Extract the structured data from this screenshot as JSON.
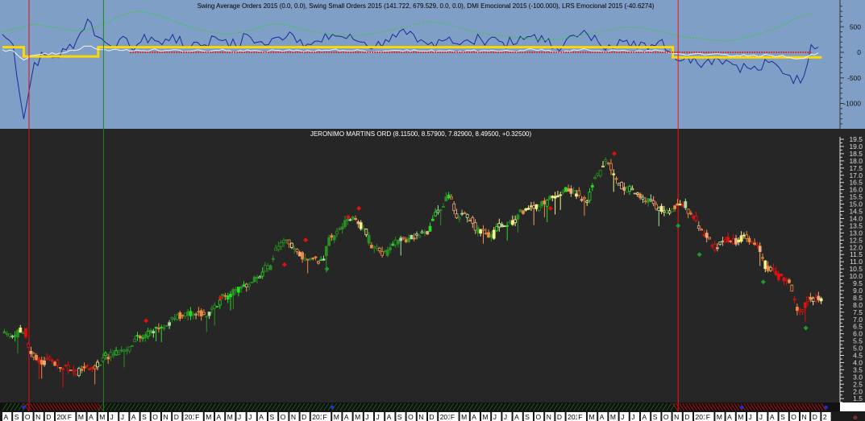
{
  "top_panel": {
    "title": "Swing Average Orders 2015 (0.0, 0.0), Swing Small Orders 2015 (141.722, 679.529, 0.0, 0.0), DMI Emocional 2015 (-100.000), LRS Emocional 2015 (-40.6274)",
    "y_ticks": [
      "500",
      "0",
      "-500",
      "-1000"
    ]
  },
  "price_panel": {
    "title": "JERONIMO MARTINS ORD (8.11500, 8.57900, 7.82900, 8.49500, +0.32500)"
  },
  "colors": {
    "top_bg": "#7f9fc6",
    "price_bg": "#262626",
    "blue_line": "#1a2a9a",
    "yellow_line": "#ffd800",
    "green_dotted": "#2fd02f",
    "red_dotted": "#e01818",
    "white_line": "#f0f0f0",
    "up_dark": "#2a8f22",
    "up_bright": "#22dd22",
    "up_light": "#a8e0a0",
    "neutral": "#f5f08a",
    "down_orange": "#f08a40",
    "down_light": "#f2a878",
    "down_red": "#e01010"
  },
  "chart_data": [
    {
      "type": "line",
      "title": "Swing Average Orders 2015 / Swing Small Orders 2015 / DMI Emocional 2015 / LRS Emocional 2015",
      "x_start": "2008-08",
      "ylim": [
        -1500,
        900
      ],
      "y_ticks": [
        500,
        0,
        -500,
        -1000
      ],
      "series": [
        {
          "name": "Swing Small Orders (blue)",
          "values": [
            350,
            150,
            -1300,
            -200,
            -50,
            -100,
            50,
            250,
            650,
            300,
            150,
            250,
            100,
            200,
            300,
            150,
            350,
            100,
            200,
            150,
            300,
            250,
            100,
            350,
            200,
            150,
            300,
            400,
            250,
            150,
            200,
            350,
            300,
            250,
            200,
            100,
            250,
            300,
            350,
            200,
            150,
            250,
            300,
            150,
            200,
            250,
            300,
            200,
            150,
            250,
            350,
            200,
            100,
            250,
            300,
            350,
            200,
            150,
            250,
            100,
            200,
            150,
            250,
            -50,
            -150,
            -100,
            -200,
            -100,
            -150,
            -250,
            -300,
            -350,
            -200,
            -300,
            -450,
            -600,
            150
          ]
        },
        {
          "name": "DMI Emocional (yellow)",
          "values": [
            100,
            100,
            -80,
            -80,
            -80,
            -80,
            -80,
            -80,
            -80,
            100,
            100,
            100,
            100,
            100,
            100,
            100,
            100,
            100,
            100,
            100,
            100,
            100,
            100,
            100,
            100,
            100,
            100,
            100,
            100,
            100,
            100,
            100,
            100,
            100,
            100,
            100,
            100,
            100,
            100,
            100,
            100,
            100,
            100,
            100,
            100,
            100,
            100,
            100,
            100,
            100,
            100,
            100,
            100,
            100,
            100,
            100,
            100,
            100,
            100,
            100,
            100,
            100,
            100,
            -100,
            -100,
            -100,
            -100,
            -100,
            -100,
            -100,
            -100,
            -100,
            -100,
            -100,
            -100,
            -100,
            -100
          ]
        },
        {
          "name": "LRS Emocional (white)",
          "values": [
            50,
            30,
            -150,
            -60,
            -20,
            -40,
            0,
            40,
            120,
            60,
            30,
            40,
            20,
            30,
            50,
            20,
            50,
            10,
            30,
            20,
            40,
            30,
            10,
            50,
            30,
            20,
            40,
            50,
            30,
            20,
            30,
            50,
            40,
            30,
            30,
            10,
            30,
            40,
            50,
            30,
            20,
            30,
            40,
            20,
            30,
            30,
            40,
            30,
            20,
            30,
            50,
            30,
            10,
            30,
            40,
            50,
            30,
            20,
            30,
            10,
            30,
            20,
            30,
            -20,
            -40,
            -30,
            -50,
            -30,
            -40,
            -60,
            -70,
            -80,
            -50,
            -70,
            -100,
            -120,
            -40
          ]
        },
        {
          "name": "Green dotted",
          "values": [
            400,
            450,
            500,
            550,
            520,
            480,
            450,
            420,
            450,
            500,
            600,
            700,
            780,
            800,
            760,
            700,
            620,
            540,
            480,
            420,
            380,
            350,
            380,
            420,
            480,
            540,
            560,
            520,
            460,
            420,
            380,
            350,
            330,
            320,
            340,
            380,
            420,
            460,
            500,
            560,
            600,
            580,
            540,
            480,
            420,
            380,
            340,
            320,
            300,
            280,
            260,
            240,
            250,
            280,
            320,
            360,
            400,
            440,
            480,
            500,
            480,
            440,
            400,
            350,
            300,
            280,
            260,
            240,
            220,
            250,
            300,
            350,
            420,
            500,
            600,
            700,
            760
          ]
        },
        {
          "name": "Red dotted",
          "values": [
            null,
            null,
            null,
            null,
            null,
            null,
            null,
            null,
            null,
            null,
            null,
            null,
            0,
            0,
            0,
            0,
            0,
            0,
            0,
            0,
            0,
            0,
            0,
            0,
            0,
            0,
            0,
            0,
            0,
            0,
            0,
            0,
            0,
            0,
            0,
            0,
            0,
            0,
            0,
            0,
            0,
            0,
            0,
            0,
            0,
            0,
            0,
            0,
            0,
            0,
            0,
            0,
            0,
            0,
            0,
            0,
            0,
            0,
            0,
            0,
            0,
            0,
            0,
            0,
            0,
            0,
            0,
            0,
            0,
            0,
            0,
            0,
            0,
            0,
            0,
            0,
            0
          ]
        }
      ]
    },
    {
      "type": "candlestick",
      "title": "JERONIMO MARTINS ORD",
      "x_start": "2008-08",
      "x_unit": "month",
      "ylim": [
        1.5,
        19.5
      ],
      "y_ticks": [
        "19.5",
        "19.0",
        "18.5",
        "18.0",
        "17.5",
        "17.0",
        "16.5",
        "16.0",
        "15.5",
        "15.0",
        "14.5",
        "14.0",
        "13.5",
        "13.0",
        "12.5",
        "12.0",
        "11.5",
        "11.0",
        "10.5",
        "10.0",
        "9.5",
        "9.0",
        "8.5",
        "8.0",
        "7.5",
        "7.0",
        "6.5",
        "6.0",
        "5.5",
        "5.0",
        "4.5",
        "4.0",
        "3.5",
        "3.0",
        "2.5",
        "2.0",
        "1.5"
      ],
      "monthly_close": [
        6.0,
        6.2,
        4.5,
        4.1,
        4.0,
        3.8,
        3.3,
        3.6,
        3.8,
        4.5,
        4.8,
        5.0,
        5.8,
        6.1,
        6.4,
        6.9,
        7.2,
        7.5,
        7.3,
        7.8,
        8.6,
        8.9,
        9.3,
        10.0,
        10.6,
        12.0,
        12.4,
        11.5,
        11.2,
        11.0,
        12.6,
        13.5,
        14.0,
        13.4,
        12.0,
        11.6,
        12.4,
        12.5,
        12.8,
        13.0,
        14.5,
        15.5,
        14.2,
        14.0,
        13.2,
        12.8,
        13.5,
        13.8,
        14.5,
        14.8,
        15.0,
        15.6,
        16.0,
        15.8,
        15.2,
        17.0,
        18.0,
        16.4,
        16.0,
        15.5,
        15.3,
        14.6,
        14.6,
        15.0,
        14.0,
        13.0,
        12.0,
        12.5,
        12.4,
        12.8,
        12.0,
        10.5,
        10.0,
        9.5,
        7.5,
        8.5,
        8.4
      ],
      "signals": [
        {
          "type": "sell",
          "date": "2009-09",
          "price": 6.9
        },
        {
          "type": "sell",
          "date": "2010-04",
          "price": 8.5
        },
        {
          "type": "sell",
          "date": "2010-10",
          "price": 10.8
        },
        {
          "type": "sell",
          "date": "2010-12",
          "price": 12.5
        },
        {
          "type": "buy",
          "date": "2011-02",
          "price": 10.5
        },
        {
          "type": "sell",
          "date": "2011-04",
          "price": 14.1
        },
        {
          "type": "sell",
          "date": "2011-05",
          "price": 14.7
        },
        {
          "type": "sell",
          "date": "2012-11",
          "price": 14.7
        },
        {
          "type": "sell",
          "date": "2013-05",
          "price": 18.5
        },
        {
          "type": "buy",
          "date": "2013-11",
          "price": 13.5
        },
        {
          "type": "buy",
          "date": "2014-01",
          "price": 11.5
        },
        {
          "type": "buy",
          "date": "2014-07",
          "price": 9.6
        },
        {
          "type": "buy",
          "date": "2014-11",
          "price": 6.4
        }
      ],
      "vertical_markers": [
        {
          "date": "2008-10",
          "color": "#e01010"
        },
        {
          "date": "2009-05",
          "color": "#1c8a1c"
        },
        {
          "date": "2013-11",
          "color": "#ff1010"
        }
      ],
      "trend_strip": [
        {
          "from": "2008-08",
          "to": "2008-09",
          "state": "up"
        },
        {
          "from": "2008-10",
          "to": "2009-04",
          "state": "down"
        },
        {
          "from": "2009-05",
          "to": "2013-10",
          "state": "up"
        },
        {
          "from": "2013-11",
          "to": "2014-12",
          "state": "down"
        }
      ]
    }
  ],
  "x_axis": {
    "labels": [
      "A",
      "S",
      "O",
      "N",
      "D",
      "2009",
      "F",
      "M",
      "A",
      "M",
      "J",
      "J",
      "A",
      "S",
      "O",
      "N",
      "D",
      "2010",
      "F",
      "M",
      "A",
      "M",
      "J",
      "J",
      "A",
      "S",
      "O",
      "N",
      "D",
      "2011",
      "F",
      "M",
      "A",
      "M",
      "J",
      "J",
      "A",
      "S",
      "O",
      "N",
      "D",
      "2012",
      "F",
      "M",
      "A",
      "M",
      "J",
      "J",
      "A",
      "S",
      "O",
      "N",
      "D",
      "2013",
      "F",
      "M",
      "A",
      "M",
      "J",
      "J",
      "A",
      "S",
      "O",
      "N",
      "D",
      "2014",
      "F",
      "M",
      "A",
      "M",
      "J",
      "J",
      "A",
      "S",
      "O",
      "N",
      "D",
      "2"
    ]
  }
}
